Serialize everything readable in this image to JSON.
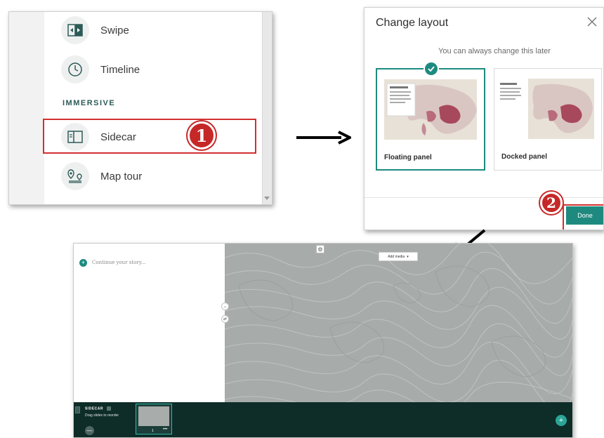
{
  "menu": {
    "items": [
      {
        "label": "Swipe",
        "icon": "swipe-icon"
      },
      {
        "label": "Timeline",
        "icon": "clock-icon"
      },
      {
        "label": "Sidecar",
        "icon": "sidecar-icon"
      },
      {
        "label": "Map tour",
        "icon": "map-tour-icon"
      }
    ],
    "section_label": "IMMERSIVE",
    "step_badge": "1"
  },
  "dialog": {
    "title": "Change layout",
    "subtitle": "You can always change this later",
    "options": [
      {
        "label": "Floating panel",
        "selected": true
      },
      {
        "label": "Docked panel",
        "selected": false
      }
    ],
    "done_label": "Done",
    "step_badge": "2"
  },
  "editor": {
    "continue_placeholder": "Continue your story...",
    "add_media_label": "Add media",
    "sidecar_label": "SIDECAR",
    "drag_hint": "Drag slides to reorder",
    "slide_number": "1"
  },
  "colors": {
    "accent": "#1e8a7f",
    "highlight_red": "#d32f2f",
    "bottom_bar": "#0e2c28"
  }
}
